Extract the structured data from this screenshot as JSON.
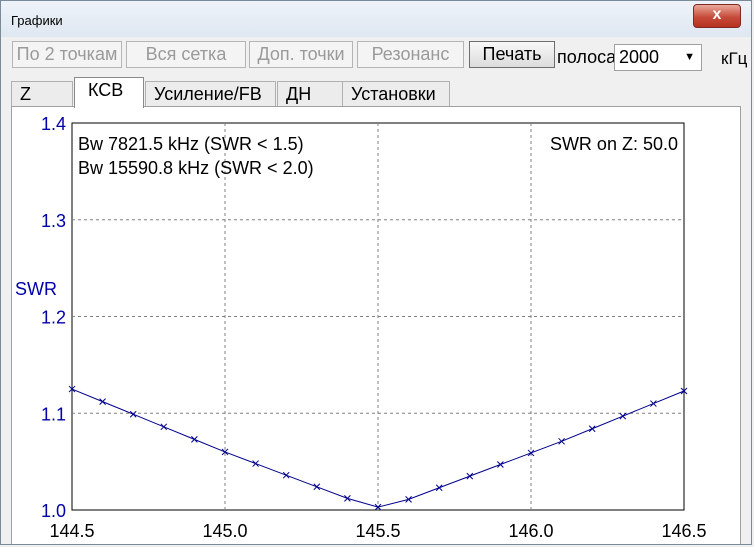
{
  "window": {
    "title": "Графики",
    "close_label": "x"
  },
  "toolbar": {
    "buttons": [
      {
        "label": "По 2 точкам",
        "enabled": false
      },
      {
        "label": "Вся сетка",
        "enabled": false
      },
      {
        "label": "Доп. точки",
        "enabled": false
      },
      {
        "label": "Резонанс",
        "enabled": false
      },
      {
        "label": "Печать",
        "enabled": true
      }
    ],
    "band_label": "полоса",
    "band_value": "2000",
    "unit_label": "кГц"
  },
  "tabs": [
    {
      "label": "Z",
      "selected": false
    },
    {
      "label": "КСВ",
      "selected": true
    },
    {
      "label": "Усиление/FB",
      "selected": false
    },
    {
      "label": "ДН",
      "selected": false
    },
    {
      "label": "Установки",
      "selected": false
    }
  ],
  "colors": {
    "axis_text": "#0000aa",
    "curve": "#00008b",
    "grid": "#808080"
  },
  "chart_data": {
    "type": "line",
    "ylabel": "SWR",
    "xlim": [
      144.5,
      146.5
    ],
    "ylim": [
      1.0,
      1.4
    ],
    "xticks": [
      "144.5",
      "145.0",
      "145.5",
      "146.0",
      "146.5"
    ],
    "yticks": [
      "1.4",
      "1.3",
      "1.2",
      "1.1",
      "1.0"
    ],
    "grid": true,
    "annotations": {
      "bw1": "Bw 7821.5 kHz (SWR < 1.5)",
      "bw2": "Bw 15590.8 kHz (SWR < 2.0)",
      "z": "SWR on Z: 50.0"
    },
    "series": [
      {
        "x": [
          144.5,
          144.6,
          144.7,
          144.8,
          144.9,
          145.0,
          145.1,
          145.2,
          145.3,
          145.4,
          145.5,
          145.6,
          145.7,
          145.8,
          145.9,
          146.0,
          146.1,
          146.2,
          146.3,
          146.4,
          146.5
        ],
        "y": [
          1.125,
          1.112,
          1.099,
          1.086,
          1.073,
          1.06,
          1.048,
          1.036,
          1.024,
          1.012,
          1.003,
          1.011,
          1.023,
          1.035,
          1.047,
          1.059,
          1.071,
          1.084,
          1.097,
          1.11,
          1.123
        ]
      }
    ]
  }
}
